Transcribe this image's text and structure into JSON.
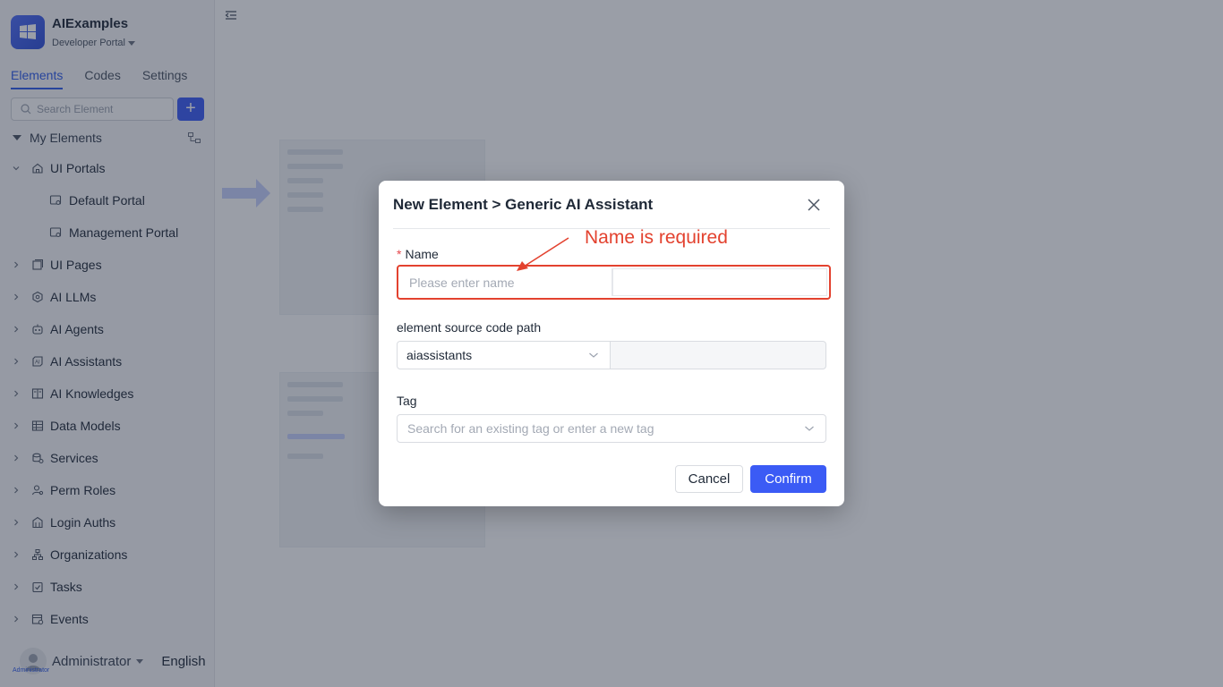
{
  "app": {
    "name": "AIExamples",
    "portal": "Developer Portal"
  },
  "sidebar": {
    "tabs": [
      "Elements",
      "Codes",
      "Settings"
    ],
    "search_placeholder": "Search Element",
    "add_label": "+",
    "section_title": "My Elements",
    "items": [
      {
        "label": "UI Portals",
        "icon": "home-icon"
      },
      {
        "label": "Default Portal",
        "icon": "portal-icon"
      },
      {
        "label": "Management Portal",
        "icon": "portal-icon"
      },
      {
        "label": "UI Pages",
        "icon": "pages-icon"
      },
      {
        "label": "AI LLMs",
        "icon": "cube-icon"
      },
      {
        "label": "AI Agents",
        "icon": "robot-icon"
      },
      {
        "label": "AI Assistants",
        "icon": "ai-icon"
      },
      {
        "label": "AI Knowledges",
        "icon": "book-icon"
      },
      {
        "label": "Data Models",
        "icon": "table-icon"
      },
      {
        "label": "Services",
        "icon": "database-icon"
      },
      {
        "label": "Perm Roles",
        "icon": "user-role-icon"
      },
      {
        "label": "Login Auths",
        "icon": "building-icon"
      },
      {
        "label": "Organizations",
        "icon": "org-icon"
      },
      {
        "label": "Tasks",
        "icon": "task-icon"
      },
      {
        "label": "Events",
        "icon": "event-icon"
      }
    ]
  },
  "footer": {
    "user": "Administrator",
    "avatar_tag": "Administrator",
    "language": "English"
  },
  "modal": {
    "title": "New Element > Generic AI Assistant",
    "name_label": "Name",
    "name_required_mark": "*",
    "name_placeholder": "Please enter name",
    "name_value": "",
    "annotation": "Name is required",
    "path_label": "element source code path",
    "path_select_value": "aiassistants",
    "tag_label": "Tag",
    "tag_placeholder": "Search for an existing tag or enter a new tag",
    "cancel_label": "Cancel",
    "confirm_label": "Confirm"
  },
  "colors": {
    "accent": "#3b5bf5",
    "error": "#e3422f"
  }
}
